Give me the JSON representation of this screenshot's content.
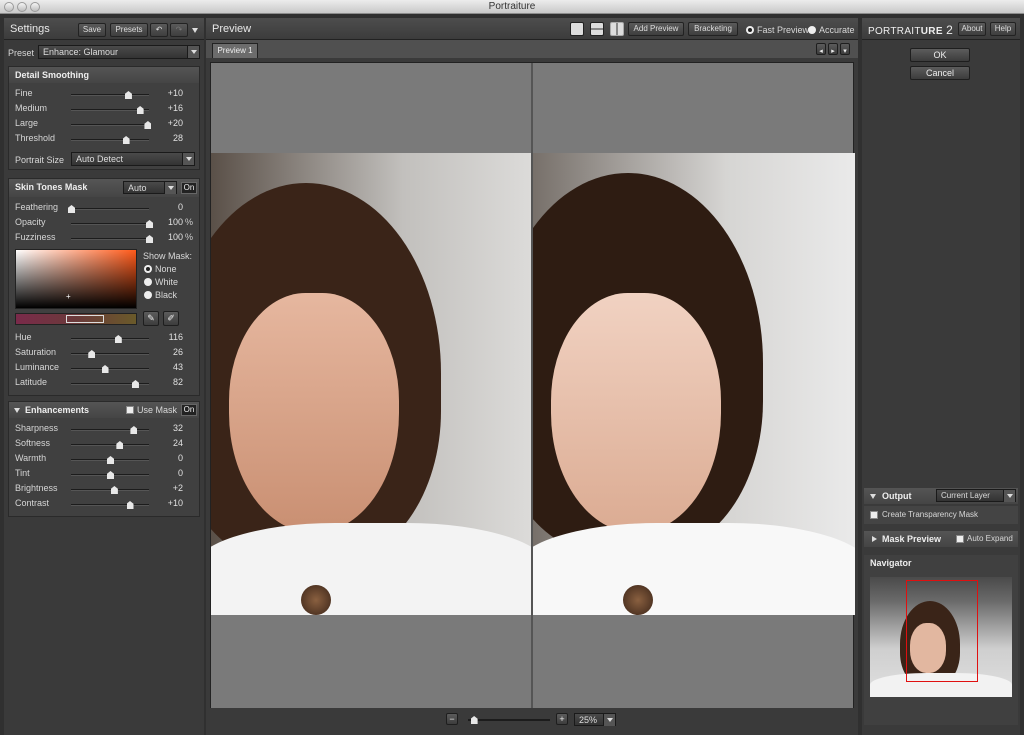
{
  "window": {
    "title": "Portraiture"
  },
  "settings": {
    "title": "Settings",
    "save_label": "Save",
    "presets_label": "Presets",
    "preset_label": "Preset",
    "preset_value": "Enhance: Glamour"
  },
  "detail_smoothing": {
    "title": "Detail Smoothing",
    "sliders": [
      {
        "label": "Fine",
        "value": "+10",
        "pos": 0.73
      },
      {
        "label": "Medium",
        "value": "+16",
        "pos": 0.88
      },
      {
        "label": "Large",
        "value": "+20",
        "pos": 0.98
      },
      {
        "label": "Threshold",
        "value": "28",
        "pos": 0.7
      }
    ],
    "portrait_size_label": "Portrait Size",
    "portrait_size_value": "Auto Detect"
  },
  "skin_tones": {
    "title": "Skin Tones Mask",
    "mode_value": "Auto",
    "on_label": "On",
    "sliders": [
      {
        "label": "Feathering",
        "value": "0",
        "pct": "",
        "pos": 0.0
      },
      {
        "label": "Opacity",
        "value": "100",
        "pct": "%",
        "pos": 1.0
      },
      {
        "label": "Fuzziness",
        "value": "100",
        "pct": "%",
        "pos": 1.0
      }
    ],
    "show_mask_label": "Show Mask:",
    "mask_options": [
      "None",
      "White",
      "Black"
    ],
    "mask_selected": "None",
    "color_sliders": [
      {
        "label": "Hue",
        "value": "116",
        "pos": 0.6
      },
      {
        "label": "Saturation",
        "value": "26",
        "pos": 0.26
      },
      {
        "label": "Luminance",
        "value": "43",
        "pos": 0.43
      },
      {
        "label": "Latitude",
        "value": "82",
        "pos": 0.82
      }
    ]
  },
  "enhancements": {
    "title": "Enhancements",
    "use_mask_label": "Use Mask",
    "on_label": "On",
    "sliders": [
      {
        "label": "Sharpness",
        "value": "32",
        "pos": 0.8
      },
      {
        "label": "Softness",
        "value": "24",
        "pos": 0.62
      },
      {
        "label": "Warmth",
        "value": "0",
        "pos": 0.5
      },
      {
        "label": "Tint",
        "value": "0",
        "pos": 0.5
      },
      {
        "label": "Brightness",
        "value": "+2",
        "pos": 0.55
      },
      {
        "label": "Contrast",
        "value": "+10",
        "pos": 0.75
      }
    ]
  },
  "preview": {
    "title": "Preview",
    "add_preview_label": "Add Preview",
    "bracketing_label": "Bracketing",
    "fast_preview_label": "Fast Preview",
    "accurate_label": "Accurate",
    "tab_label": "Preview 1",
    "zoom_value": "25%",
    "zoom_pos": 0.02
  },
  "right": {
    "logo_a": "PORTRAIT",
    "logo_b": "URE",
    "logo_num": "2",
    "about_label": "About",
    "help_label": "Help",
    "ok_label": "OK",
    "cancel_label": "Cancel",
    "output_label": "Output",
    "output_value": "Current Layer",
    "transparency_label": "Create Transparency Mask",
    "mask_preview_label": "Mask Preview",
    "auto_expand_label": "Auto Expand",
    "navigator_label": "Navigator"
  },
  "colors": {
    "accent_red": "#e01010",
    "panel": "#3a3a3a"
  }
}
